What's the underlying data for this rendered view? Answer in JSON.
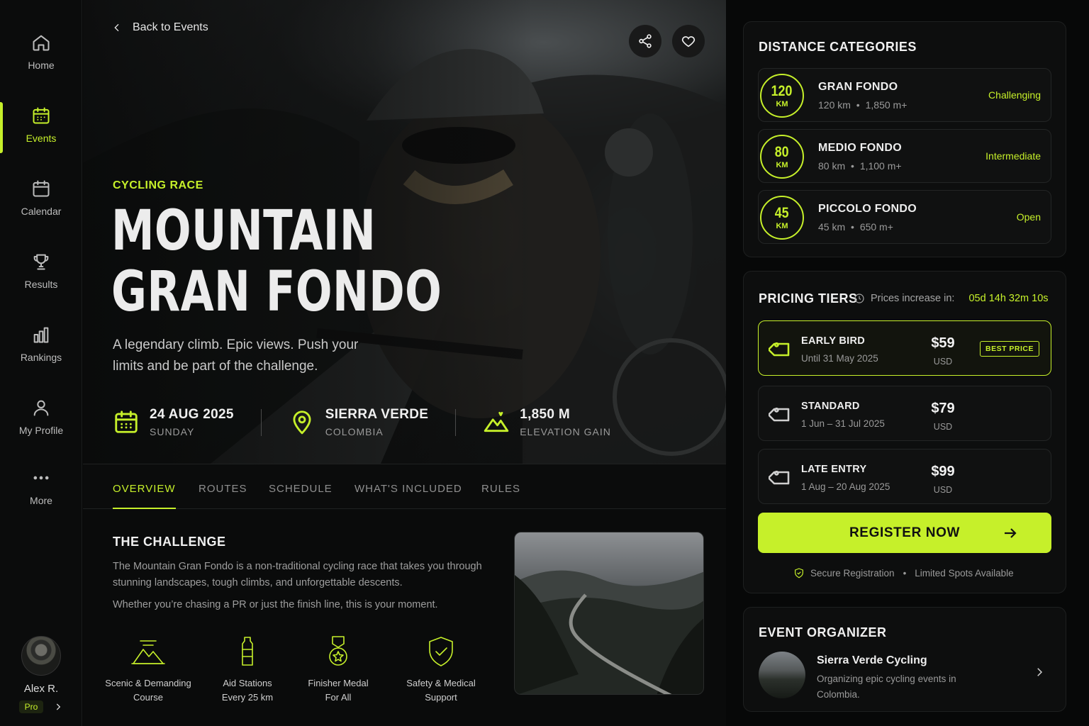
{
  "theme": {
    "accent": "#c6f02a",
    "background": "#070808"
  },
  "sidebar": {
    "items": [
      {
        "label": "Home",
        "icon": "home-icon"
      },
      {
        "label": "Events",
        "icon": "calendar-grid-icon",
        "active": true
      },
      {
        "label": "Calendar",
        "icon": "calendar-icon"
      },
      {
        "label": "Results",
        "icon": "trophy-icon"
      },
      {
        "label": "Rankings",
        "icon": "bar-chart-icon"
      },
      {
        "label": "My Profile",
        "icon": "user-icon"
      },
      {
        "label": "More",
        "icon": "more-dots-icon"
      }
    ],
    "user": {
      "name": "Alex R.",
      "badge": "Pro"
    }
  },
  "hero": {
    "back_label": "Back to Events",
    "kicker": "CYCLING RACE",
    "title_line1": "MOUNTAIN",
    "title_line2": "GRAN FONDO",
    "tagline": "A legendary climb. Epic views. Push your limits and be part of the challenge.",
    "date": {
      "main": "24 AUG 2025",
      "sub": "SUNDAY"
    },
    "location": {
      "main": "SIERRA VERDE",
      "sub": "COLOMBIA"
    },
    "elevation": {
      "main": "1,850 M",
      "sub": "ELEVATION GAIN"
    }
  },
  "tabs": [
    "OVERVIEW",
    "ROUTES",
    "SCHEDULE",
    "WHAT'S INCLUDED",
    "RULES"
  ],
  "overview": {
    "title": "THE CHALLENGE",
    "paragraph1": "The Mountain Gran Fondo is a non-traditional cycling race that takes you through stunning landscapes, tough climbs, and unforgettable descents.",
    "paragraph2": "Whether you’re chasing a PR or just the finish line, this is your moment.",
    "features": [
      {
        "line1": "Scenic & Demanding",
        "line2": "Course",
        "icon": "mountain-icon"
      },
      {
        "line1": "Aid Stations",
        "line2": "Every 25 km",
        "icon": "water-bottle-icon"
      },
      {
        "line1": "Finisher Medal",
        "line2": "For All",
        "icon": "medal-icon"
      },
      {
        "line1": "Safety & Medical",
        "line2": "Support",
        "icon": "shield-check-icon"
      }
    ]
  },
  "distances": {
    "title": "DISTANCE CATEGORIES",
    "items": [
      {
        "km": "120",
        "unit": "KM",
        "name": "GRAN FONDO",
        "distance": "120 km",
        "elevation": "1,850 m+",
        "level": "Challenging"
      },
      {
        "km": "80",
        "unit": "KM",
        "name": "MEDIO FONDO",
        "distance": "80 km",
        "elevation": "1,100 m+",
        "level": "Intermediate"
      },
      {
        "km": "45",
        "unit": "KM",
        "name": "PICCOLO FONDO",
        "distance": "45 km",
        "elevation": "650 m+",
        "level": "Open"
      }
    ]
  },
  "pricing": {
    "title": "PRICING TIERS",
    "timer_label": "Prices increase in:",
    "timer_value": "05d 14h 32m 10s",
    "tiers": [
      {
        "name": "EARLY BIRD",
        "dates": "Until 31 May 2025",
        "price": "$59",
        "currency": "USD",
        "badge": "BEST PRICE"
      },
      {
        "name": "STANDARD",
        "dates": "1 Jun – 31 Jul 2025",
        "price": "$79",
        "currency": "USD"
      },
      {
        "name": "LATE ENTRY",
        "dates": "1 Aug – 20 Aug 2025",
        "price": "$99",
        "currency": "USD"
      }
    ],
    "register_label": "REGISTER NOW",
    "secure_label": "Secure Registration",
    "spots_label": "Limited Spots Available"
  },
  "organizer": {
    "title": "EVENT ORGANIZER",
    "name": "Sierra Verde Cycling",
    "description": "Organizing epic cycling events in Colombia."
  }
}
